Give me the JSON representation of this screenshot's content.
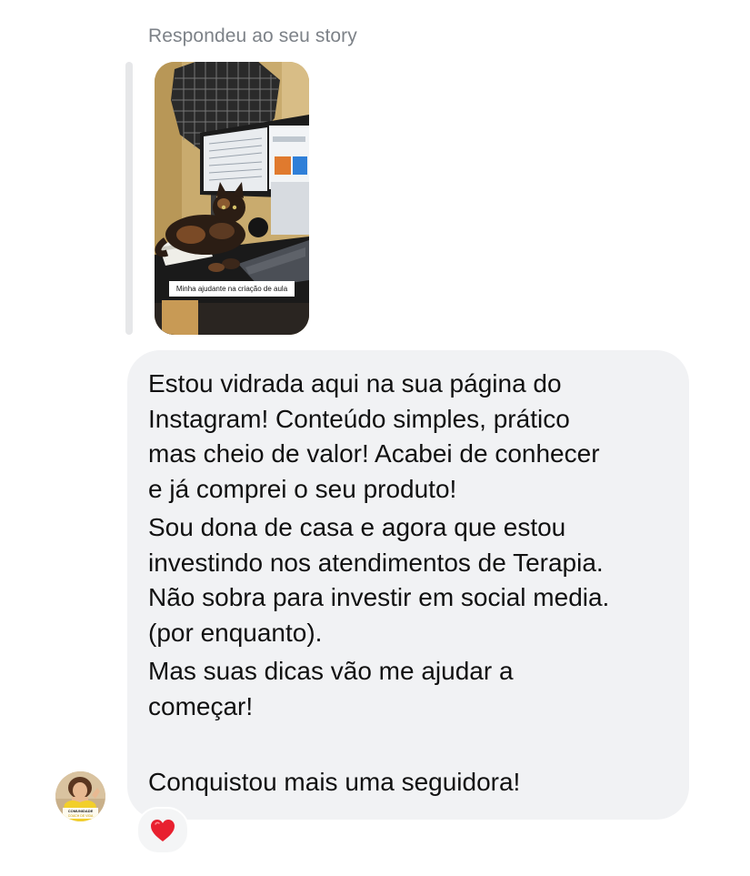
{
  "reply": {
    "header": "Respondeu ao seu story"
  },
  "story": {
    "caption": "Minha ajudante na criação de aula"
  },
  "message": {
    "lines": [
      "Estou vidrada aqui na sua página do",
      "Instagram! Conteúdo simples, prático",
      "mas cheio de valor! Acabei de conhecer",
      "e já comprei o seu produto!",
      "Sou dona de casa e agora que estou",
      "investindo nos atendimentos de Terapia.",
      "Não sobra para investir em social media.",
      "(por enquanto).",
      "Mas suas dicas vão me ajudar a",
      "começar!",
      "Conquistou mais uma seguidora!"
    ]
  },
  "reaction": {
    "icon": "heart-icon",
    "color": "#e8202f"
  },
  "avatar": {
    "text_top": "COMUNIDADE",
    "text_bottom": "COACH DE VIDA"
  },
  "colors": {
    "bubble": "#f1f2f4",
    "meta_text": "#7d8288",
    "quote_bar": "#e6e7e9"
  }
}
